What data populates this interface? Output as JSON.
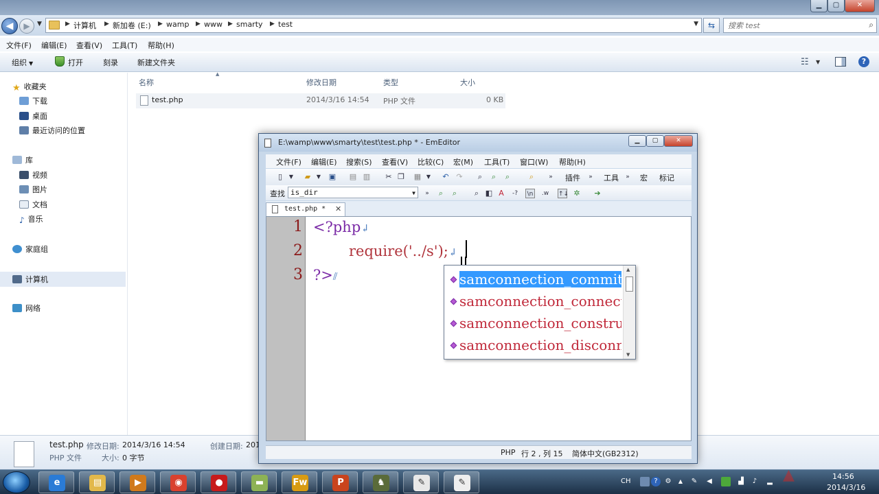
{
  "explorer": {
    "breadcrumbs": [
      "计算机",
      "新加卷 (E:)",
      "wamp",
      "www",
      "smarty",
      "test"
    ],
    "search_placeholder": "搜索 test",
    "menu": [
      "文件(F)",
      "编辑(E)",
      "查看(V)",
      "工具(T)",
      "帮助(H)"
    ],
    "commands": {
      "organize": "组织",
      "open": "打开",
      "burn": "刻录",
      "new_folder": "新建文件夹"
    },
    "nav": {
      "favorites": "收藏夹",
      "favorites_items": [
        "下载",
        "桌面",
        "最近访问的位置"
      ],
      "libraries": "库",
      "libraries_items": [
        "视频",
        "图片",
        "文档",
        "音乐"
      ],
      "homegroup": "家庭组",
      "computer": "计算机",
      "network": "网络"
    },
    "columns": {
      "name": "名称",
      "modified": "修改日期",
      "type": "类型",
      "size": "大小"
    },
    "files": [
      {
        "name": "test.php",
        "modified": "2014/3/16 14:54",
        "type": "PHP 文件",
        "size": "0 KB"
      }
    ],
    "details": {
      "name": "test.php",
      "modified_label": "修改日期:",
      "modified": "2014/3/16 14:54",
      "type": "PHP 文件",
      "size_label": "大小:",
      "size": "0 字节",
      "created_label": "创建日期:",
      "created": "201"
    }
  },
  "emeditor": {
    "title": "E:\\wamp\\www\\smarty\\test\\test.php * - EmEditor",
    "menu": [
      "文件(F)",
      "编辑(E)",
      "搜索(S)",
      "查看(V)",
      "比较(C)",
      "宏(M)",
      "工具(T)",
      "窗口(W)",
      "帮助(H)"
    ],
    "toolbar_labels": {
      "plugins": "插件",
      "tools": "工具",
      "macro": "宏",
      "marker": "标记"
    },
    "find_label": "查找",
    "find_value": "is_dir",
    "tab": "test.php *",
    "line_numbers": [
      "1",
      "2",
      "3"
    ],
    "code": {
      "line1": "<?php",
      "line2_fn": "require",
      "line2_args": "('../s');",
      "line3": "?>"
    },
    "autocomplete": [
      "samconnection_commit",
      "samconnection_connect",
      "samconnection_constructor",
      "samconnection_disconnect"
    ],
    "status": {
      "mode": "PHP",
      "position": "行 2 , 列 15",
      "encoding": "简体中文(GB2312)"
    }
  },
  "taskbar": {
    "apps": [
      {
        "name": "ie",
        "color": "#2a7bd6",
        "glyph": "e"
      },
      {
        "name": "explorer",
        "color": "#e2b84a",
        "glyph": "▤"
      },
      {
        "name": "media-player",
        "color": "#d07a1c",
        "glyph": "▶"
      },
      {
        "name": "chrome",
        "color": "#d9412e",
        "glyph": "◉"
      },
      {
        "name": "recorder",
        "color": "#c71b1b",
        "glyph": "●"
      },
      {
        "name": "notepad-green",
        "color": "#8db255",
        "glyph": "▬"
      },
      {
        "name": "fireworks",
        "color": "#d89b12",
        "glyph": "Fw"
      },
      {
        "name": "powerpoint",
        "color": "#c9441d",
        "glyph": "P"
      },
      {
        "name": "games",
        "color": "#5a6b3a",
        "glyph": "♞"
      },
      {
        "name": "notepad",
        "color": "#e8e8e8",
        "glyph": "✎"
      },
      {
        "name": "emeditor",
        "color": "#eeeeee",
        "glyph": "✎"
      }
    ],
    "tray": {
      "lang": "CH",
      "time": "14:56",
      "date": "2014/3/16"
    }
  }
}
